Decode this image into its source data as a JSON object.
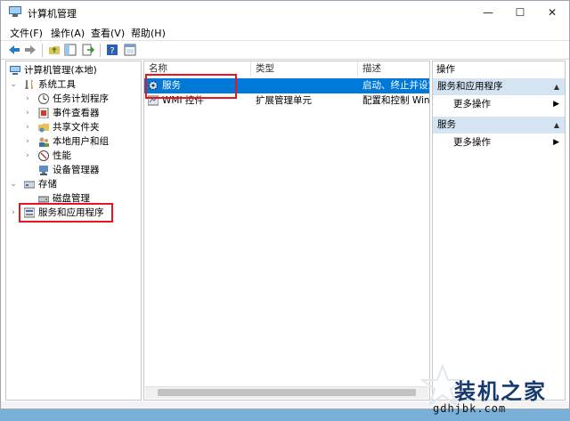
{
  "window": {
    "title": "计算机管理",
    "minimize": "—",
    "maximize": "☐",
    "close": "✕"
  },
  "menu": [
    "文件(F)",
    "操作(A)",
    "查看(V)",
    "帮助(H)"
  ],
  "tree": {
    "root": "计算机管理(本地)",
    "system_tools": "系统工具",
    "task_scheduler": "任务计划程序",
    "event_viewer": "事件查看器",
    "shared_folders": "共享文件夹",
    "local_users": "本地用户和组",
    "performance": "性能",
    "device_manager": "设备管理器",
    "storage": "存储",
    "disk_management": "磁盘管理",
    "services_apps": "服务和应用程序"
  },
  "list": {
    "columns": {
      "name": "名称",
      "type": "类型",
      "description": "描述"
    },
    "rows": [
      {
        "name": "服务",
        "type": "",
        "description": "启动、终止并设置"
      },
      {
        "name": "WMI 控件",
        "type": "扩展管理单元",
        "description": "配置和控制 Winc"
      }
    ]
  },
  "actions": {
    "header": "操作",
    "section1": "服务和应用程序",
    "more1": "更多操作",
    "section2": "服务",
    "more2": "更多操作"
  },
  "watermark": {
    "brand": "装机之家",
    "url": "gdhjbk.com"
  },
  "colors": {
    "selection": "#0078d7",
    "highlight_box": "#e8141e",
    "action_section_bg": "#d5e4f3"
  }
}
